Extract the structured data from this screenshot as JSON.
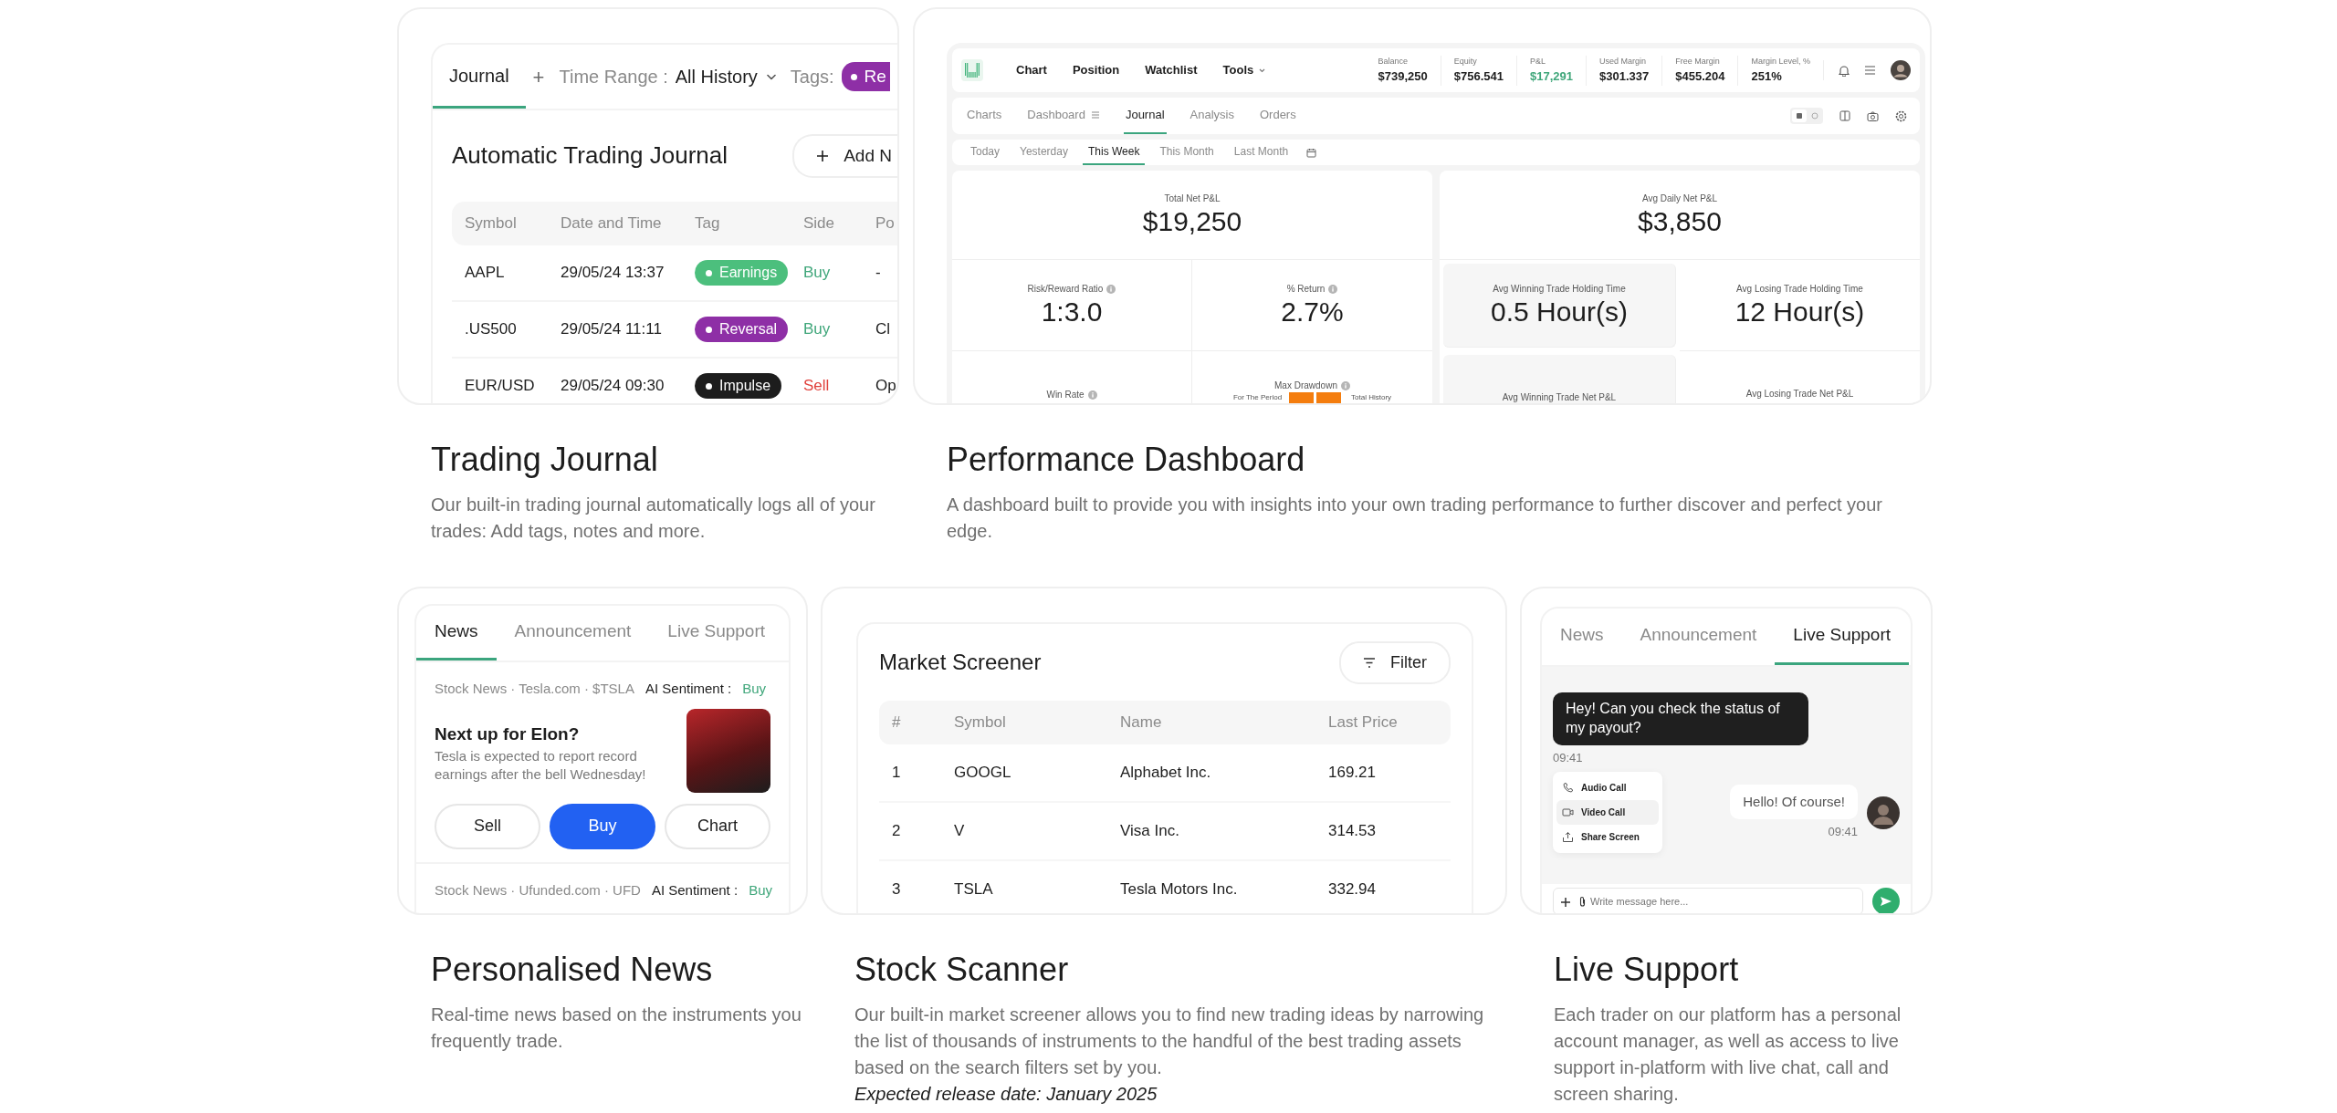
{
  "trading_journal": {
    "preview": {
      "tabs": [
        {
          "label": "Journal",
          "selected": true
        }
      ],
      "add_tab": "+",
      "time_range_label": "Time Range :",
      "time_range_value": "All History",
      "tags_label": "Tags:",
      "tag_filter": {
        "label": "Re",
        "color": "#8e2fa6"
      },
      "title": "Automatic Trading Journal",
      "add_button": "Add N",
      "columns": [
        "Symbol",
        "Date and Time",
        "Tag",
        "Side",
        "Po"
      ],
      "rows": [
        {
          "symbol": "AAPL",
          "datetime": "29/05/24 13:37",
          "tag": {
            "label": "Earnings",
            "color": "#4cbf7d"
          },
          "side": {
            "label": "Buy",
            "kind": "buy"
          },
          "position": "-"
        },
        {
          "symbol": ".US500",
          "datetime": "29/05/24 11:11",
          "tag": {
            "label": "Reversal",
            "color": "#8e2fa6"
          },
          "side": {
            "label": "Buy",
            "kind": "buy"
          },
          "position": "Cl"
        },
        {
          "symbol": "EUR/USD",
          "datetime": "29/05/24 09:30",
          "tag": {
            "label": "Impulse",
            "color": "#1d1d1d"
          },
          "side": {
            "label": "Sell",
            "kind": "sell"
          },
          "position": "Op"
        }
      ]
    },
    "title": "Trading Journal",
    "description": "Our built-in trading journal automatically logs all of your trades: Add tags, notes and more."
  },
  "performance_dashboard": {
    "preview": {
      "nav_items": [
        {
          "label": "Chart",
          "dropdown": false
        },
        {
          "label": "Position",
          "dropdown": false
        },
        {
          "label": "Watchlist",
          "dropdown": false
        },
        {
          "label": "Tools",
          "dropdown": true
        }
      ],
      "stats": [
        {
          "label": "Balance",
          "value": "$739,250",
          "kind": "plain"
        },
        {
          "label": "Equity",
          "value": "$756.541",
          "kind": "plain"
        },
        {
          "label": "P&L",
          "value": "$17,291",
          "kind": "profit"
        },
        {
          "label": "Used Margin",
          "value": "$301.337",
          "kind": "plain"
        },
        {
          "label": "Free Margin",
          "value": "$455.204",
          "kind": "plain"
        },
        {
          "label": "Margin Level, %",
          "value": "251%",
          "kind": "plain"
        }
      ],
      "subnav": [
        {
          "label": "Charts",
          "selected": false,
          "has_menu": false
        },
        {
          "label": "Dashboard",
          "selected": false,
          "has_menu": true
        },
        {
          "label": "Journal",
          "selected": true,
          "has_menu": false
        },
        {
          "label": "Analysis",
          "selected": false,
          "has_menu": false
        },
        {
          "label": "Orders",
          "selected": false,
          "has_menu": false
        }
      ],
      "date_filters": [
        {
          "label": "Today",
          "selected": false
        },
        {
          "label": "Yesterday",
          "selected": false
        },
        {
          "label": "This Week",
          "selected": true
        },
        {
          "label": "This Month",
          "selected": false
        },
        {
          "label": "Last Month",
          "selected": false
        }
      ],
      "left_panel": {
        "headline": {
          "label": "Total Net P&L",
          "value": "$19,250"
        },
        "cells": [
          {
            "label": "Risk/Reward Ratio",
            "value": "1:3.0"
          },
          {
            "label": "% Return",
            "value": "2.7%"
          },
          {
            "label": "Win Rate"
          }
        ],
        "drawdown": {
          "label": "Max Drawdown",
          "period_label": "For The Period",
          "history_label": "Total History"
        }
      },
      "right_panel": {
        "headline": {
          "label": "Avg Daily Net P&L",
          "value": "$3,850"
        },
        "cells": [
          {
            "label": "Avg Winning Trade Holding Time",
            "value": "0.5 Hour(s)",
            "highlighted": true
          },
          {
            "label": "Avg Losing Trade Holding Time",
            "value": "12 Hour(s)",
            "highlighted": false
          },
          {
            "label": "Avg Winning Trade Net P&L",
            "highlighted": true
          },
          {
            "label": "Avg Losing Trade Net P&L",
            "highlighted": false
          }
        ]
      }
    },
    "title": "Performance Dashboard",
    "description": "A dashboard built to provide you with insights into your own trading performance to further discover and perfect your edge."
  },
  "personalised_news": {
    "preview": {
      "tabs": [
        {
          "label": "News",
          "selected": true
        },
        {
          "label": "Announcement",
          "selected": false
        },
        {
          "label": "Live Support",
          "selected": false
        }
      ],
      "items": [
        {
          "source": "Stock News · Tesla.com · $TSLA",
          "sentiment_label": "AI Sentiment :",
          "sentiment": {
            "label": "Buy",
            "kind": "buy"
          },
          "headline": "Next up for Elon?",
          "summary": "Tesla is expected to report record earnings after the bell Wednesday!",
          "has_image": true,
          "actions": [
            {
              "label": "Sell",
              "kind": "outline"
            },
            {
              "label": "Buy",
              "kind": "primary"
            },
            {
              "label": "Chart",
              "kind": "outline"
            }
          ]
        },
        {
          "source": "Stock News · Ufunded.com · UFD",
          "sentiment_label": "AI Sentiment :",
          "sentiment": {
            "label": "Buy",
            "kind": "buy"
          }
        }
      ]
    },
    "title": "Personalised News",
    "description": "Real-time news based on the instruments you frequently trade."
  },
  "stock_scanner": {
    "preview": {
      "title": "Market Screener",
      "filter_button": "Filter",
      "columns": [
        "#",
        "Symbol",
        "Name",
        "Last Price"
      ],
      "rows": [
        [
          "1",
          "GOOGL",
          "Alphabet Inc.",
          "169.21"
        ],
        [
          "2",
          "V",
          "Visa Inc.",
          "314.53"
        ],
        [
          "3",
          "TSLA",
          "Tesla Motors Inc.",
          "332.94"
        ]
      ]
    },
    "title": "Stock Scanner",
    "description": "Our built-in market screener allows you to find new trading ideas by narrowing the list of thousands of instruments to the handful of the best trading assets based on the search filters set by you.",
    "note": "Expected release date: January 2025"
  },
  "live_support": {
    "preview": {
      "tabs": [
        {
          "label": "News",
          "selected": false
        },
        {
          "label": "Announcement",
          "selected": false
        },
        {
          "label": "Live Support",
          "selected": true
        }
      ],
      "messages": [
        {
          "kind": "sent",
          "text": "Hey! Can you check the status of my payout?",
          "time": "09:41"
        },
        {
          "kind": "received",
          "text": "Hello! Of course!",
          "time": "09:41"
        }
      ],
      "call_menu": [
        {
          "label": "Audio Call",
          "kind": "audio",
          "selected": false
        },
        {
          "label": "Video Call",
          "kind": "video",
          "selected": true
        },
        {
          "label": "Share Screen",
          "kind": "share",
          "selected": false
        }
      ],
      "input": {
        "placeholder": "Write message here..."
      }
    },
    "title": "Live Support",
    "description": "Each trader on our platform has a personal account manager, as well as access to live support in-platform with live chat, call and screen sharing."
  }
}
